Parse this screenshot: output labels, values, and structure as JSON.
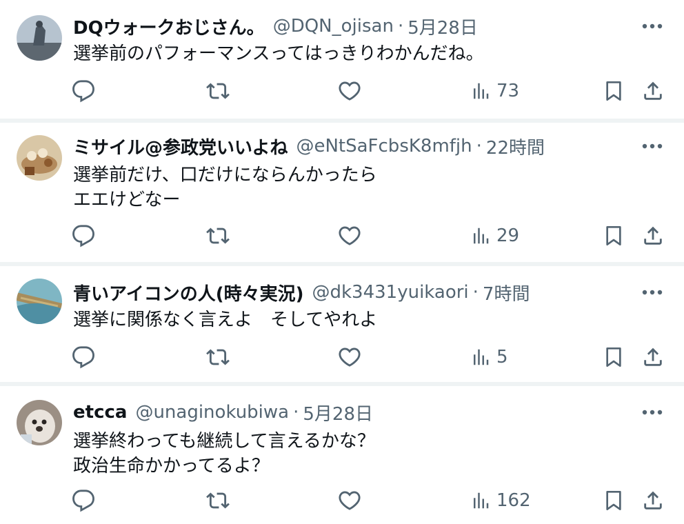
{
  "tweets": [
    {
      "name": "DQウォークおじさん。",
      "handle": "@DQN_ojisan",
      "separator": "·",
      "time": "5月28日",
      "text": "選挙前のパフォーマンスってはっきりわかんだね。",
      "views": "73",
      "avatar_color": "#7f8d9a"
    },
    {
      "name": "ミサイル@参政党いいよね",
      "handle": "@eNtSaFcbsK8mfjh",
      "separator": "·",
      "time": "22時間",
      "text": "選挙前だけ、口だけにならんかったら\nエエけどなー",
      "views": "29",
      "avatar_color": "#c9a37a"
    },
    {
      "name": "青いアイコンの人(時々実況)",
      "handle": "@dk3431yuikaori",
      "separator": "·",
      "time": "7時間",
      "text": "選挙に関係なく言えよ　そしてやれよ",
      "views": "5",
      "avatar_color": "#6aa6b8"
    },
    {
      "name": "etcca",
      "handle": "@unaginokubiwa",
      "separator": "·",
      "time": "5月28日",
      "text": "選挙終わっても継続して言えるかな？\n政治生命かかってるよ？",
      "views": "162",
      "avatar_color": "#8a7f74"
    }
  ],
  "icons": {
    "more": "more-icon",
    "reply": "reply-icon",
    "retweet": "retweet-icon",
    "like": "like-icon",
    "views": "views-icon",
    "bookmark": "bookmark-icon",
    "share": "share-icon"
  },
  "colors": {
    "text_primary": "#0f1419",
    "text_secondary": "#536471",
    "divider": "#eff3f4"
  }
}
